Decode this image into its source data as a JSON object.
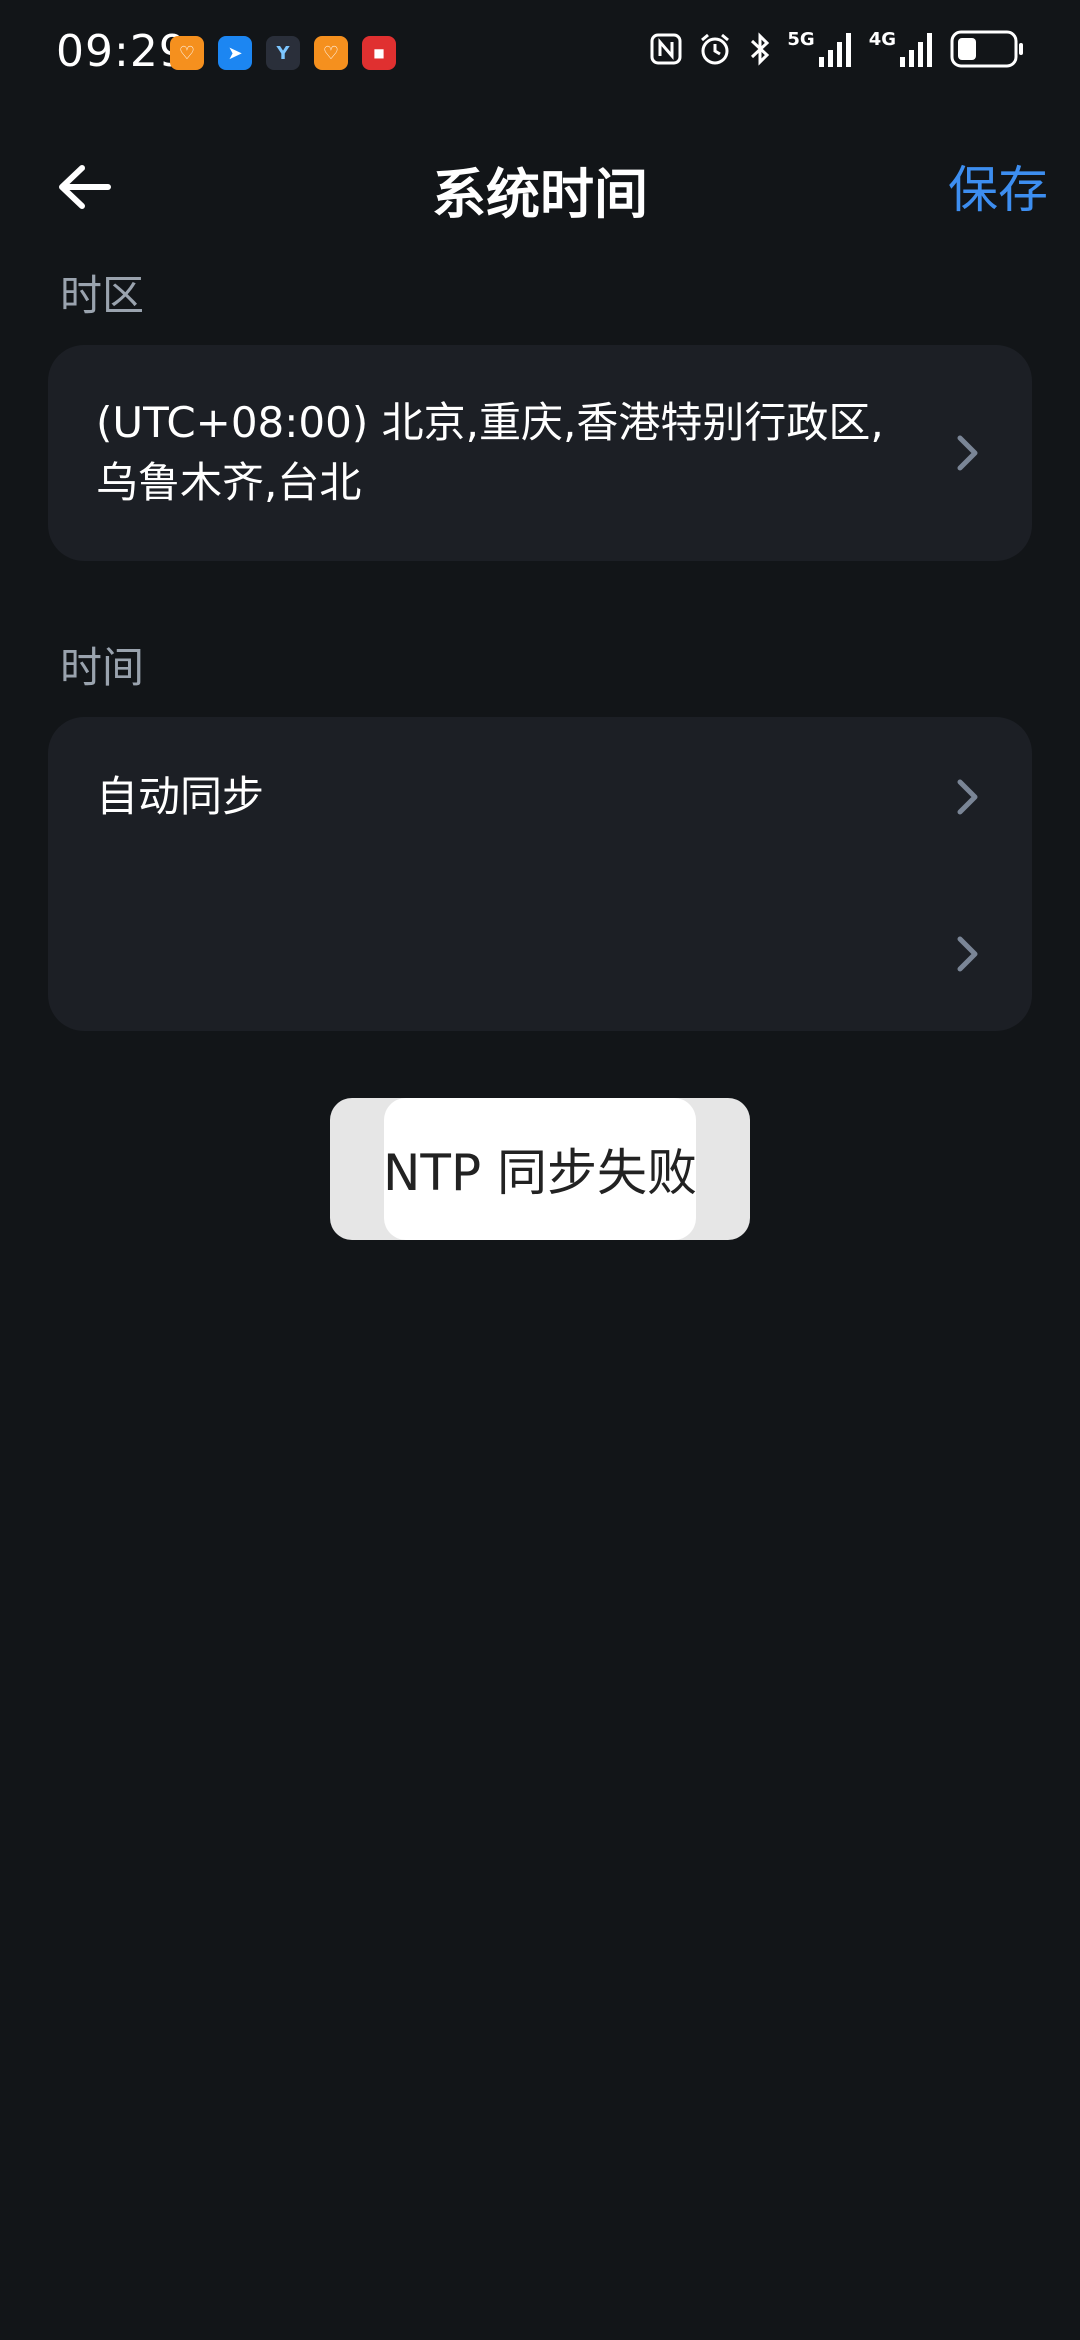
{
  "status_bar": {
    "time": "09:29",
    "notification_icons": [
      "orange-app-icon",
      "blue-app-icon",
      "dark-app-icon",
      "orange-app-icon",
      "red-app-icon"
    ],
    "signal_5g": "5G",
    "signal_4g": "4G"
  },
  "header": {
    "title": "系统时间",
    "save_label": "保存"
  },
  "timezone_section": {
    "label": "时区",
    "value": "(UTC+08:00) 北京,重庆,香港特别行政区,乌鲁木齐,台北"
  },
  "time_section": {
    "label": "时间",
    "rows": [
      {
        "label": "自动同步"
      },
      {
        "label": ""
      }
    ]
  },
  "toast": {
    "message": "NTP 同步失败"
  },
  "colors": {
    "background": "#121518",
    "card": "#1c1f25",
    "accent": "#3d8ef0",
    "section_label": "#9aa3ae",
    "chevron": "#7a8596"
  }
}
